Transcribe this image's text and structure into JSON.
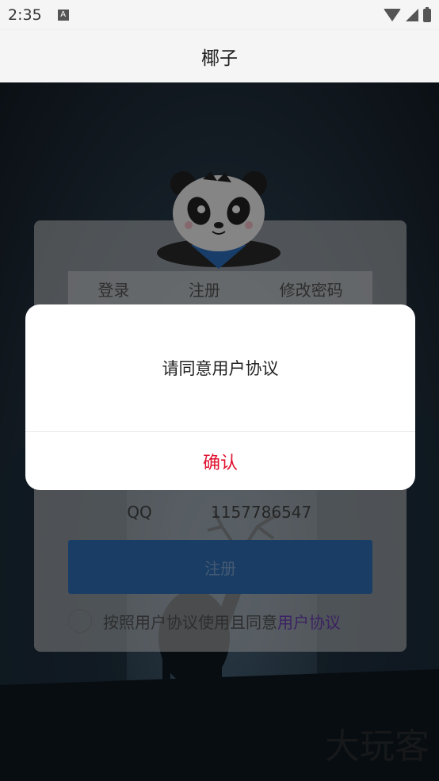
{
  "status_bar": {
    "time": "2:35",
    "notification_icon": "A"
  },
  "app_bar": {
    "title": "椰子"
  },
  "background_form": {
    "tabs": [
      "登录",
      "注册",
      "修改密码"
    ],
    "qq_label": "QQ",
    "qq_value": "1157786547",
    "register_button": "注册",
    "agreement_text": "按照用户协议使用且同意",
    "agreement_link": "用户协议"
  },
  "watermark": "大玩客",
  "dialog": {
    "message": "请同意用户协议",
    "confirm_label": "确认"
  },
  "colors": {
    "accent_red": "#e0102f",
    "register_blue": "#2f6fb8",
    "link_purple": "#6c3fb5"
  }
}
